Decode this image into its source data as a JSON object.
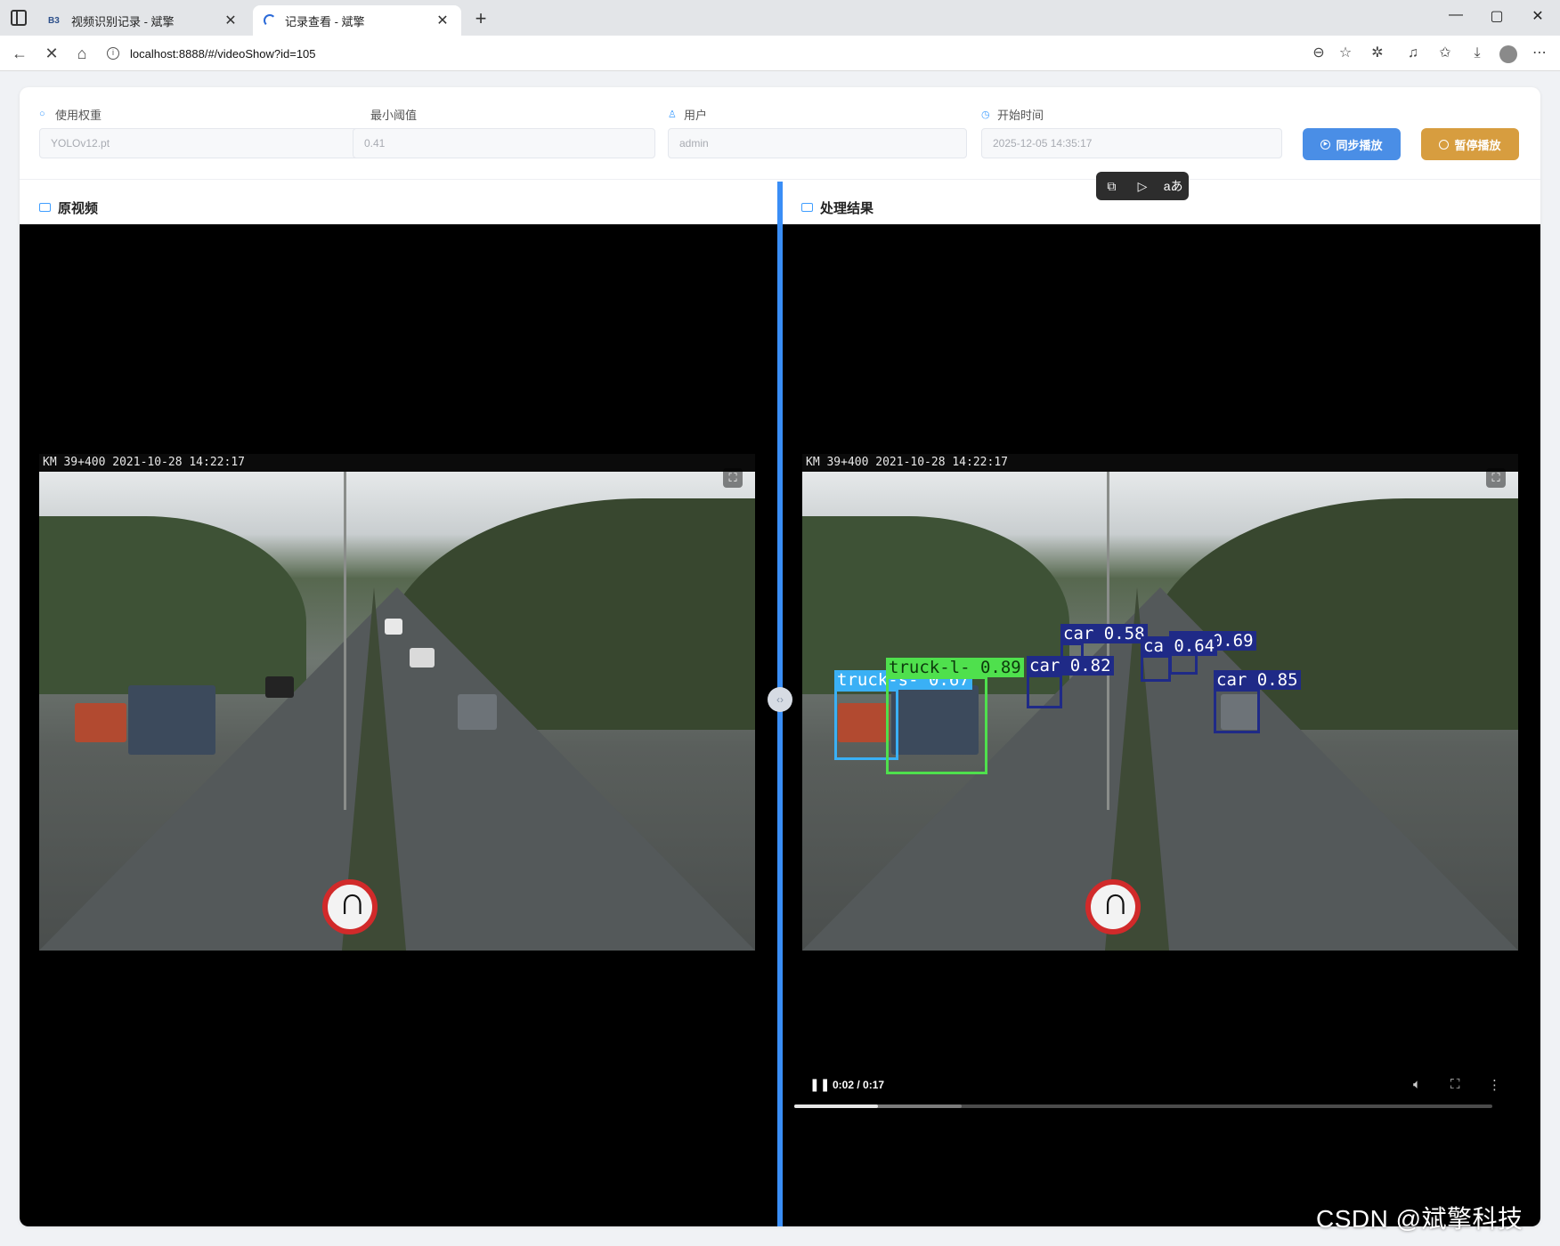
{
  "browser": {
    "tabs": [
      {
        "favicon": "B3",
        "title": "视频识别记录 - 斌擎",
        "active": false
      },
      {
        "favicon": "loading-spinner",
        "title": "记录查看 - 斌擎",
        "active": true
      }
    ],
    "url": "localhost:8888/#/videoShow?id=105",
    "window_controls": [
      "—",
      "▢",
      "✕"
    ]
  },
  "form": {
    "weight": {
      "label": "使用权重",
      "value": "YOLOv12.pt",
      "icon": "circle-icon"
    },
    "threshold": {
      "label": "最小阈值",
      "value": "0.41"
    },
    "user": {
      "label": "用户",
      "value": "admin",
      "icon": "user-icon"
    },
    "start_time": {
      "label": "开始时间",
      "value": "2025-12-05 14:35:17",
      "icon": "clock-icon"
    }
  },
  "buttons": {
    "sync": "同步播放",
    "pause": "暂停播放"
  },
  "sections": {
    "original": "原视频",
    "result": "处理结果"
  },
  "video": {
    "osd": "KM 39+400 2021-10-28 14:22:17",
    "detections": [
      {
        "label": "car 0.58",
        "color": "navy"
      },
      {
        "label": "car 0.69",
        "color": "navy"
      },
      {
        "label": "car 0.82",
        "color": "navy"
      },
      {
        "label": "ca 0.64",
        "color": "navy"
      },
      {
        "label": "car 0.85",
        "color": "navy"
      },
      {
        "label": "truck-l- 0.89",
        "color": "green"
      },
      {
        "label": "truck-s- 0.67",
        "color": "blue"
      }
    ],
    "player": {
      "time": "0:02 / 0:17",
      "progress": 0.12,
      "buffered": 0.24
    }
  },
  "colors": {
    "accent": "#409eff",
    "sync_button": "#4a8ee6",
    "pause_button": "#d79d3f",
    "divider": "#3a8ef6"
  },
  "watermark": "CSDN @斌擎科技"
}
